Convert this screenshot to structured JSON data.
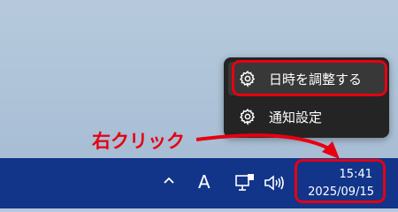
{
  "context_menu": {
    "items": [
      {
        "label": "日時を調整する",
        "icon": "gear-icon"
      },
      {
        "label": "通知設定",
        "icon": "gear-icon"
      }
    ]
  },
  "annotation": {
    "label": "右クリック",
    "color": "#e60012"
  },
  "taskbar": {
    "tray": {
      "chevron_icon": "chevron-up-icon",
      "ime_indicator": "A",
      "network_icon": "network-icon",
      "volume_icon": "speaker-icon"
    },
    "clock": {
      "time": "15:41",
      "date": "2025/09/15"
    },
    "color": "#12358a"
  }
}
